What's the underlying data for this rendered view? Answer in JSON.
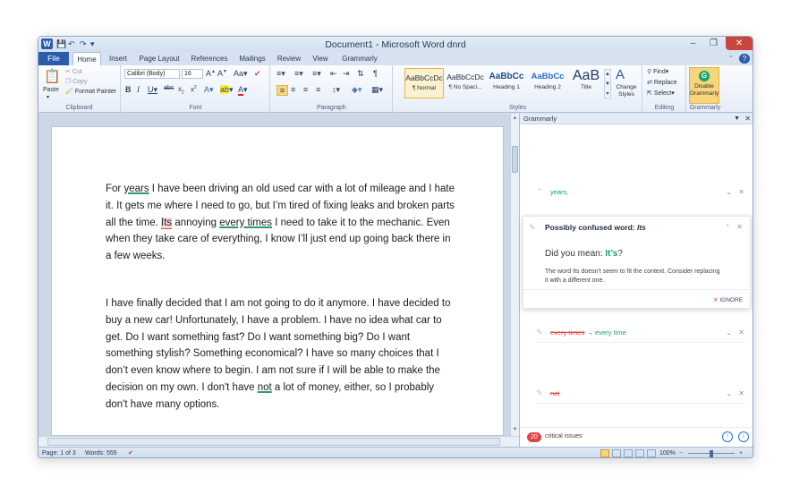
{
  "window": {
    "title": "Document1 - Microsoft Word dnrd",
    "logo": "W",
    "controls": {
      "minimize": "–",
      "restore": "❐",
      "close": "✕"
    }
  },
  "tabs": {
    "file": "File",
    "items": [
      "Home",
      "Insert",
      "Page Layout",
      "References",
      "Mailings",
      "Review",
      "View",
      "Grammarly"
    ]
  },
  "ribbon": {
    "clipboard": {
      "paste": "Paste",
      "cut": "Cut",
      "copy": "Copy",
      "format_painter": "Format Painter",
      "label": "Clipboard"
    },
    "font": {
      "font_name": "Calibri (Body)",
      "font_size": "16",
      "label": "Font"
    },
    "paragraph": {
      "label": "Paragraph"
    },
    "styles": {
      "label": "Styles",
      "items": [
        {
          "sample": "AaBbCcDc",
          "name": "¶ Normal"
        },
        {
          "sample": "AaBbCcDc",
          "name": "¶ No Spaci..."
        },
        {
          "sample": "AaBbCc",
          "name": "Heading 1"
        },
        {
          "sample": "AaBbCc",
          "name": "Heading 2"
        },
        {
          "sample": "AaB",
          "name": "Title"
        }
      ],
      "change_styles": "Change Styles"
    },
    "editing": {
      "find": "Find",
      "replace": "Replace",
      "select": "Select",
      "label": "Editing"
    },
    "grammarly": {
      "disable": "Disable Grammarly",
      "label": "Grammarly"
    }
  },
  "document": {
    "para1": {
      "t1": "For ",
      "u_years": "years",
      "t2": " I have been driving an old used car with a lot of mileage and I hate it. It gets me where I need to go, but I’m tired of fixing leaks and broken parts all the time. ",
      "u_its": "Its",
      "t3": " annoying ",
      "u_every": "every times",
      "t4": " I need to take it to the mechanic. Even when they take care of everything, I know I’ll just end up going back there in a few weeks."
    },
    "para2": {
      "t1": "I have finally decided that I am not going to do it anymore. I have decided to buy a new car! Unfortunately, I have a problem. I have no idea what car to get. Do I want something fast? Do I want something big? Do I want something stylish? Something economical? I have so many choices that I don’t even know where to begin. I am not sure if I will be able to make the decision on my own. I don't have ",
      "u_not": "not",
      "t2": " a lot of money, either, so I probably don't have many options."
    }
  },
  "grammarly_panel": {
    "title": "Grammarly",
    "cards": [
      {
        "suggestion": "years,"
      },
      {
        "title_prefix": "Possibly confused word: ",
        "title_word": "Its",
        "did_you_mean": "Did you mean: ",
        "replacement": "It’s",
        "question_mark": "?",
        "explain": "The word Its doesn't seem to fit the context. Consider replacing it with a different one.",
        "ignore": "IGNORE"
      },
      {
        "old": "every times",
        "arrow": "→",
        "new": "every time"
      },
      {
        "removed": "not"
      }
    ],
    "footer": {
      "count": "20",
      "label": "critical issues"
    }
  },
  "statusbar": {
    "page": "Page: 1 of 3",
    "words": "Words: 555",
    "zoom": "100%"
  },
  "colors": {
    "accent": "#2a5caa",
    "grammarly_green": "#15a36b",
    "error_red": "#e04444"
  }
}
